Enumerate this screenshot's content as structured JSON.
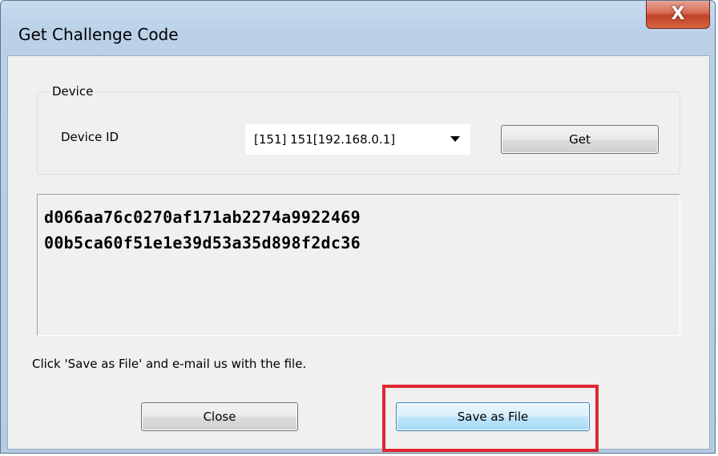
{
  "window": {
    "title": "Get Challenge Code",
    "close_glyph": "X"
  },
  "device_group": {
    "legend": "Device",
    "device_id_label": "Device ID",
    "device_select_value": "[151] 151[192.168.0.1]",
    "get_button_label": "Get"
  },
  "output": {
    "lines": [
      "d066aa76c0270af171ab2274a9922469",
      "00b5ca60f51e1e39d53a35d898f2dc36"
    ]
  },
  "hint": "Click 'Save as File' and e-mail us with the file.",
  "buttons": {
    "close_label": "Close",
    "save_label": "Save as File"
  },
  "colors": {
    "highlight": "#e02633",
    "close_button": "#c2432a",
    "dialog_background": "#f0f0f0"
  }
}
